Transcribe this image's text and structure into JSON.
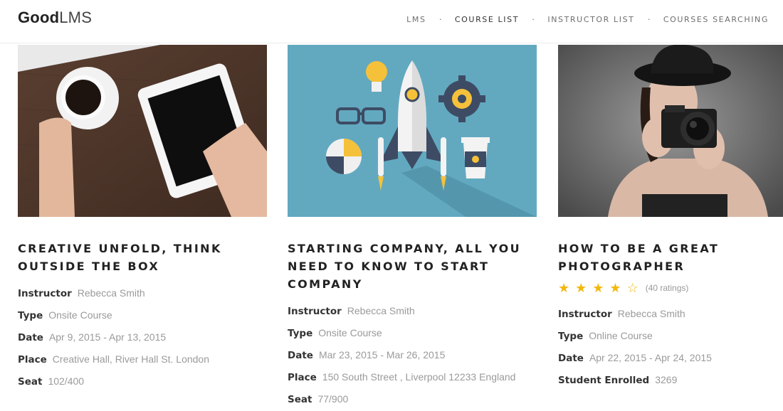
{
  "logo": {
    "bold": "Good",
    "light": "LMS"
  },
  "nav": [
    {
      "label": "LMS"
    },
    {
      "label": "COURSE LIST"
    },
    {
      "label": "INSTRUCTOR LIST"
    },
    {
      "label": "COURSES SEARCHING"
    }
  ],
  "courses": [
    {
      "title": "CREATIVE UNFOLD, THINK OUTSIDE THE BOX",
      "fields": [
        {
          "k": "Instructor",
          "v": "Rebecca Smith"
        },
        {
          "k": "Type",
          "v": "Onsite Course"
        },
        {
          "k": "Date",
          "v": "Apr 9, 2015 - Apr 13, 2015"
        },
        {
          "k": "Place",
          "v": "Creative Hall, River Hall St. London"
        },
        {
          "k": "Seat",
          "v": "102/400"
        }
      ]
    },
    {
      "title": "STARTING COMPANY, ALL YOU NEED TO KNOW TO START COMPANY",
      "fields": [
        {
          "k": "Instructor",
          "v": "Rebecca Smith"
        },
        {
          "k": "Type",
          "v": "Onsite Course"
        },
        {
          "k": "Date",
          "v": "Mar 23, 2015 - Mar 26, 2015"
        },
        {
          "k": "Place",
          "v": "150 South Street , Liverpool 12233 England"
        },
        {
          "k": "Seat",
          "v": "77/900"
        }
      ]
    },
    {
      "title": "HOW TO BE A GREAT PHOTOGRAPHER",
      "rating": {
        "stars": 4,
        "max": 5,
        "count_text": "(40 ratings)"
      },
      "fields": [
        {
          "k": "Instructor",
          "v": "Rebecca Smith"
        },
        {
          "k": "Type",
          "v": "Online Course"
        },
        {
          "k": "Date",
          "v": "Apr 22, 2015 - Apr 24, 2015"
        },
        {
          "k": "Student Enrolled",
          "v": "3269"
        }
      ]
    }
  ],
  "colors": {
    "star": "#f1b90e",
    "thumb2_bg": "#62a9c0",
    "muted_text": "#9a9a9a"
  }
}
